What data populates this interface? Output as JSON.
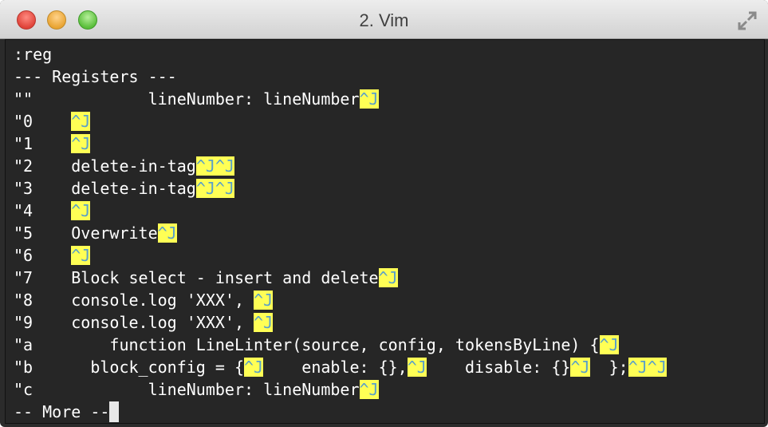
{
  "window": {
    "title": "2. Vim",
    "controls": [
      "close-icon",
      "minimize-icon",
      "maximize-icon"
    ],
    "fullscreen_icon": "fullscreen-arrows-icon"
  },
  "terminal": {
    "command": ":reg",
    "header": "--- Registers ---",
    "registers": [
      {
        "name": "\"\"",
        "content": "        lineNumber: lineNumber",
        "controls": [
          "^J"
        ]
      },
      {
        "name": "\"0",
        "content": "",
        "controls": [
          "^J"
        ]
      },
      {
        "name": "\"1",
        "content": "",
        "controls": [
          "^J"
        ]
      },
      {
        "name": "\"2",
        "content": "delete-in-tag",
        "controls": [
          "^J^J"
        ]
      },
      {
        "name": "\"3",
        "content": "delete-in-tag",
        "controls": [
          "^J^J"
        ]
      },
      {
        "name": "\"4",
        "content": "",
        "controls": [
          "^J"
        ]
      },
      {
        "name": "\"5",
        "content": "Overwrite",
        "controls": [
          "^J"
        ]
      },
      {
        "name": "\"6",
        "content": "",
        "controls": [
          "^J"
        ]
      },
      {
        "name": "\"7",
        "content": "Block select - insert and delete",
        "controls": [
          "^J"
        ]
      },
      {
        "name": "\"8",
        "content": "console.log 'XXX', ",
        "controls": [
          "^J"
        ]
      },
      {
        "name": "\"9",
        "content": "console.log 'XXX', ",
        "controls": [
          "^J"
        ]
      },
      {
        "name": "\"a",
        "content": "    function LineLinter(source, config, tokensByLine) {",
        "controls": [
          "^J"
        ]
      },
      {
        "name": "\"b",
        "content": "  block_config = {",
        "controls": [
          "^J",
          "^J",
          "^J",
          "^J^J"
        ],
        "parts": [
          "    enable: {},",
          "    disable: {}",
          "  };"
        ]
      },
      {
        "name": "\"c",
        "content": "        lineNumber: lineNumber",
        "controls": [
          "^J"
        ]
      }
    ],
    "more_prompt": "-- More --"
  },
  "colors": {
    "terminal_bg": "#262626",
    "text": "#ffffff",
    "highlight_bg": "#ffff55",
    "highlight_fg": "#5aa0c8"
  }
}
